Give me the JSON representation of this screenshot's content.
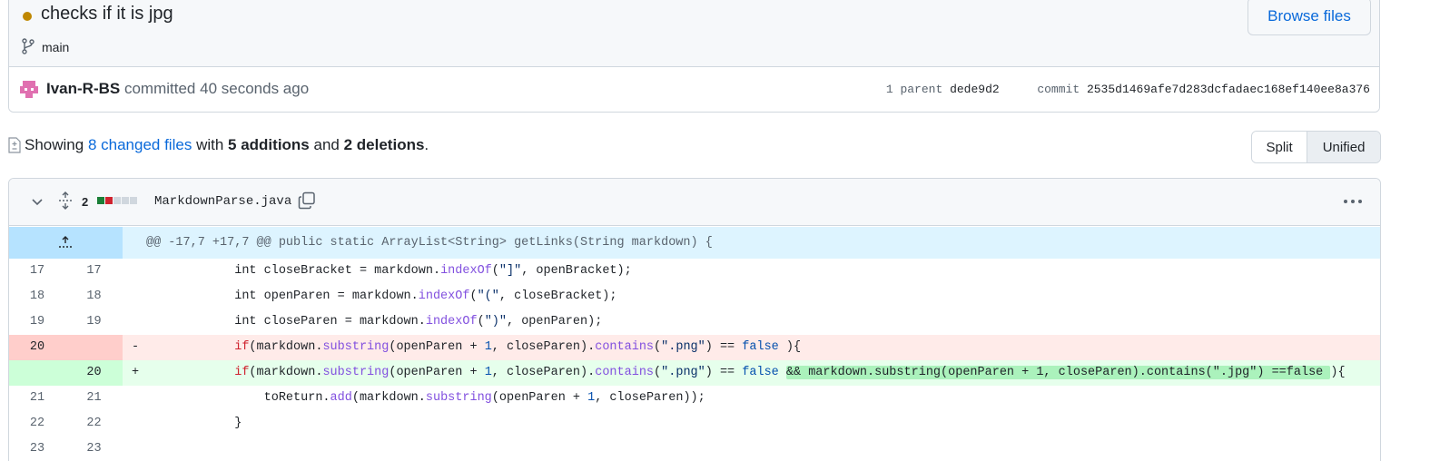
{
  "commit": {
    "title": "checks if it is jpg",
    "branch": "main",
    "browse_label": "Browse files",
    "author": "Ivan-R-BS",
    "action": "committed",
    "time": "40 seconds ago",
    "parent_label": "1 parent",
    "parent_sha": "dede9d2",
    "commit_label": "commit",
    "commit_sha": "2535d1469afe7d283dcfadaec168ef140ee8a376",
    "status_color": "#bf8700"
  },
  "summary": {
    "prefix": "Showing",
    "changed_files": "8 changed files",
    "with": "with",
    "additions": "5 additions",
    "and": "and",
    "deletions": "2 deletions",
    "suffix": "."
  },
  "view_toggle": {
    "split": "Split",
    "unified": "Unified",
    "selected": "Unified"
  },
  "file": {
    "changes": "2",
    "diffstat": [
      "added",
      "removed",
      "neutral",
      "neutral",
      "neutral"
    ],
    "name": "MarkdownParse.java",
    "hunk_header": "@@ -17,7 +17,7 @@ public static ArrayList<String> getLinks(String markdown) {",
    "lines": [
      {
        "type": "context",
        "old": "17",
        "new": "17",
        "marker": "",
        "tokens": [
          [
            "",
            "            int closeBracket = markdown."
          ],
          [
            "fn",
            "indexOf"
          ],
          [
            "",
            "("
          ],
          [
            "str",
            "\"]\""
          ],
          [
            "",
            ", openBracket);"
          ]
        ]
      },
      {
        "type": "context",
        "old": "18",
        "new": "18",
        "marker": "",
        "tokens": [
          [
            "",
            "            int openParen = markdown."
          ],
          [
            "fn",
            "indexOf"
          ],
          [
            "",
            "("
          ],
          [
            "str",
            "\"(\""
          ],
          [
            "",
            ", closeBracket);"
          ]
        ]
      },
      {
        "type": "context",
        "old": "19",
        "new": "19",
        "marker": "",
        "tokens": [
          [
            "",
            "            int closeParen = markdown."
          ],
          [
            "fn",
            "indexOf"
          ],
          [
            "",
            "("
          ],
          [
            "str",
            "\")\""
          ],
          [
            "",
            ", openParen);"
          ]
        ]
      },
      {
        "type": "del",
        "old": "20",
        "new": "",
        "marker": "-",
        "tokens": [
          [
            "",
            "            "
          ],
          [
            "kw",
            "if"
          ],
          [
            "",
            "(markdown."
          ],
          [
            "fn",
            "substring"
          ],
          [
            "",
            "(openParen + "
          ],
          [
            "num",
            "1"
          ],
          [
            "",
            ", closeParen)."
          ],
          [
            "fn",
            "contains"
          ],
          [
            "",
            "("
          ],
          [
            "str",
            "\".png\""
          ],
          [
            "",
            ") == "
          ],
          [
            "bool",
            "false"
          ],
          [
            "",
            " ){"
          ]
        ]
      },
      {
        "type": "add",
        "old": "",
        "new": "20",
        "marker": "+",
        "tokens": [
          [
            "",
            "            "
          ],
          [
            "kw",
            "if"
          ],
          [
            "",
            "(markdown."
          ],
          [
            "fn",
            "substring"
          ],
          [
            "",
            "(openParen + "
          ],
          [
            "num",
            "1"
          ],
          [
            "",
            ", closeParen)."
          ],
          [
            "fn",
            "contains"
          ],
          [
            "",
            "("
          ],
          [
            "str",
            "\".png\""
          ],
          [
            "",
            ") == "
          ],
          [
            "bool",
            "false"
          ],
          [
            "",
            " "
          ],
          [
            "hl",
            "&& markdown.substring(openParen + 1, closeParen).contains(\".jpg\") ==false "
          ],
          [
            "",
            "){"
          ]
        ]
      },
      {
        "type": "context",
        "old": "21",
        "new": "21",
        "marker": "",
        "tokens": [
          [
            "",
            "                toReturn."
          ],
          [
            "fn",
            "add"
          ],
          [
            "",
            "(markdown."
          ],
          [
            "fn",
            "substring"
          ],
          [
            "",
            "(openParen + "
          ],
          [
            "num",
            "1"
          ],
          [
            "",
            ", closeParen));"
          ]
        ]
      },
      {
        "type": "context",
        "old": "22",
        "new": "22",
        "marker": "",
        "tokens": [
          [
            "",
            "            }"
          ]
        ]
      },
      {
        "type": "context",
        "old": "23",
        "new": "23",
        "marker": "",
        "tokens": [
          [
            "",
            ""
          ]
        ]
      }
    ]
  },
  "colors": {
    "link": "#0969da",
    "addition_bg": "#e6ffec",
    "addition_gutter": "#ccffd8",
    "deletion_bg": "#ffebe9",
    "deletion_gutter": "#ffcecb",
    "hunk_bg": "#ddf4ff",
    "hunk_gutter": "#b6e3ff",
    "diffstat_added": "#1a7f37",
    "diffstat_removed": "#cf222e",
    "diffstat_neutral": "#d0d7de"
  },
  "icons": {
    "branch": "git-branch-icon",
    "avatar": "identicon-avatar",
    "file_diff": "file-diff-icon",
    "chevron": "chevron-down-icon",
    "expand": "unfold-icon",
    "copy": "copy-icon",
    "kebab": "kebab-horizontal-icon",
    "hunk_expand": "expand-up-icon"
  }
}
